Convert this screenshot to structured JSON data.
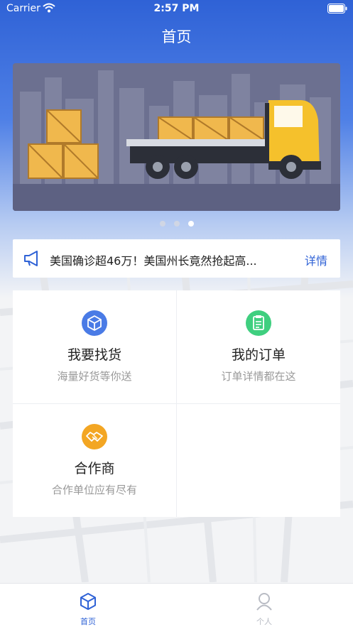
{
  "status_bar": {
    "carrier": "Carrier",
    "time": "2:57 PM"
  },
  "nav": {
    "title": "首页"
  },
  "banner": {
    "icon": "truck-with-crates-illustration",
    "slides": 3,
    "active_slide": 3
  },
  "notice": {
    "text": "美国确诊超46万！美国州长竟然抢起高...",
    "link": "详情"
  },
  "grid": [
    {
      "title": "我要找货",
      "subtitle": "海量好货等你送",
      "icon": "box-icon",
      "color": "#4a7be6"
    },
    {
      "title": "我的订单",
      "subtitle": "订单详情都在这",
      "icon": "clipboard-icon",
      "color": "#3fcf7f"
    },
    {
      "title": "合作商",
      "subtitle": "合作单位应有尽有",
      "icon": "handshake-icon",
      "color": "#f3a623"
    }
  ],
  "tabbar": {
    "items": [
      {
        "label": "首页",
        "icon": "home-box-icon",
        "active": true,
        "color": "#2f62d6"
      },
      {
        "label": "个人",
        "icon": "person-icon",
        "active": false,
        "color": "#b9bcc4"
      }
    ]
  }
}
